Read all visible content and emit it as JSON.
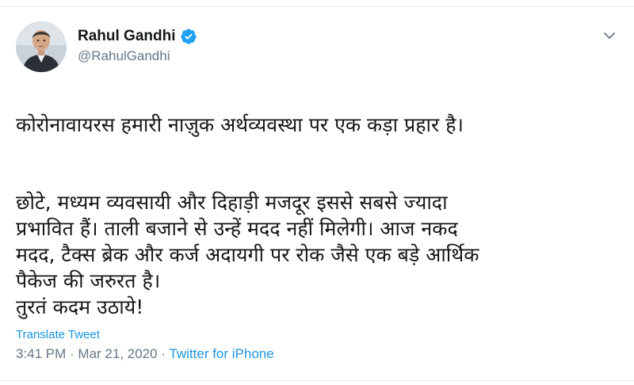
{
  "tweet": {
    "author": {
      "display_name": "Rahul Gandhi",
      "handle": "@RahulGandhi",
      "verified": true
    },
    "paragraphs": [
      "कोरोनावायरस हमारी नाज़ुक अर्थव्यवस्था पर एक कड़ा प्रहार है।",
      "छोटे, मध्यम व्यवसायी और दिहाड़ी मजदूर इससे सबसे ज्यादा\nप्रभावित हैं। ताली बजाने से उन्हें मदद नहीं मिलेगी। आज नकद\nमदद, टैक्स ब्रेक और कर्ज अदायगी पर रोक जैसे एक बड़े आर्थिक\nपैकेज की जरुरत है।\nतुरतं कदम उठाये!"
    ],
    "translate_label": "Translate Tweet",
    "time": "3:41 PM",
    "date": "Mar 21, 2020",
    "separator": " · ",
    "source": "Twitter for iPhone"
  },
  "colors": {
    "link": "#1b95e0",
    "muted": "#657786",
    "text": "#14171a",
    "verified_badge": "#1da1f2"
  },
  "icons": {
    "verified": "verified-badge-icon",
    "caret": "chevron-down-icon"
  }
}
